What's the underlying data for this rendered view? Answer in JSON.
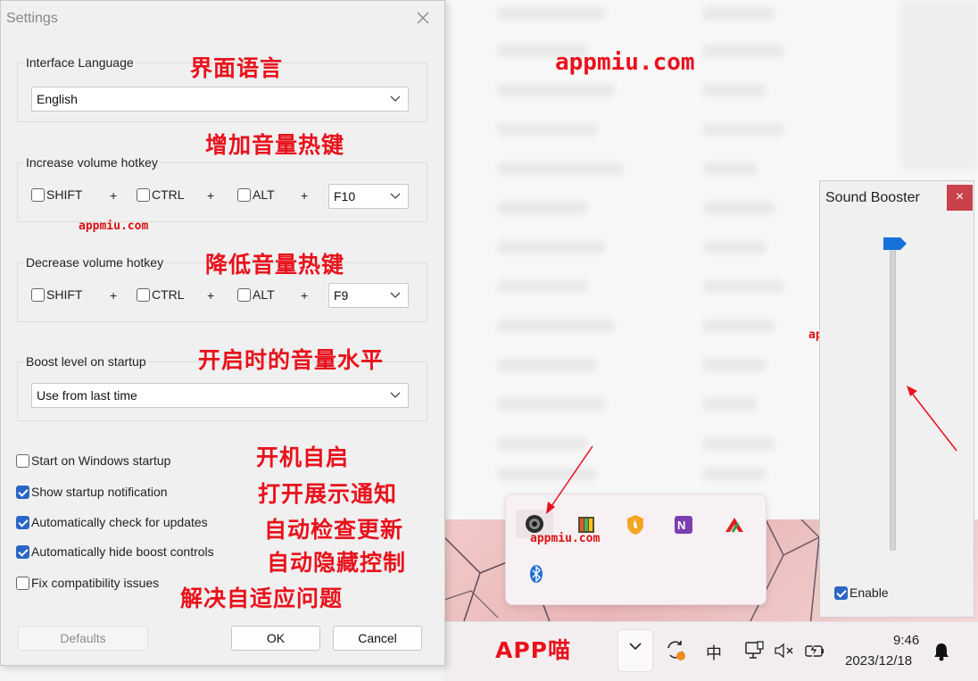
{
  "settings": {
    "title": "Settings",
    "interface_language": {
      "label": "Interface Language",
      "value": "English"
    },
    "increase_hotkey": {
      "label": "Increase volume hotkey",
      "key": "F10"
    },
    "decrease_hotkey": {
      "label": "Decrease volume hotkey",
      "key": "F9"
    },
    "modifiers": {
      "shift": "SHIFT",
      "ctrl": "CTRL",
      "alt": "ALT",
      "plus": "+"
    },
    "boost_level": {
      "label": "Boost level on startup",
      "value": "Use from last time"
    },
    "options": [
      {
        "label": "Start on Windows startup",
        "checked": false
      },
      {
        "label": "Show startup notification",
        "checked": true
      },
      {
        "label": "Automatically check for updates",
        "checked": true
      },
      {
        "label": "Automatically hide boost controls",
        "checked": true
      },
      {
        "label": "Fix compatibility issues",
        "checked": false
      }
    ],
    "buttons": {
      "defaults": "Defaults",
      "ok": "OK",
      "cancel": "Cancel"
    }
  },
  "annotations": {
    "interface_language": "界面语言",
    "increase_hotkey": "增加音量热键",
    "decrease_hotkey": "降低音量热键",
    "boost_level": "开启时的音量水平",
    "opt_startup": "开机自启",
    "opt_notification": "打开展示通知",
    "opt_updates": "自动检查更新",
    "opt_hide": "自动隐藏控制",
    "opt_fix": "解决自适应问题",
    "app_name": "APP喵"
  },
  "watermarks": {
    "big": "appmiu.com",
    "small": "appmiu.com"
  },
  "booster": {
    "title": "Sound Booster",
    "close": "×",
    "enable_label": "Enable",
    "enabled": true,
    "level": 1.0
  },
  "taskbar": {
    "ime": "中",
    "time": "9:46",
    "date": "2023/12/18",
    "chevron": "⌄",
    "mute_x": "×"
  },
  "colors": {
    "annotation": "#e8121c",
    "accent": "#2a66c5",
    "booster_close": "#c9414a"
  }
}
